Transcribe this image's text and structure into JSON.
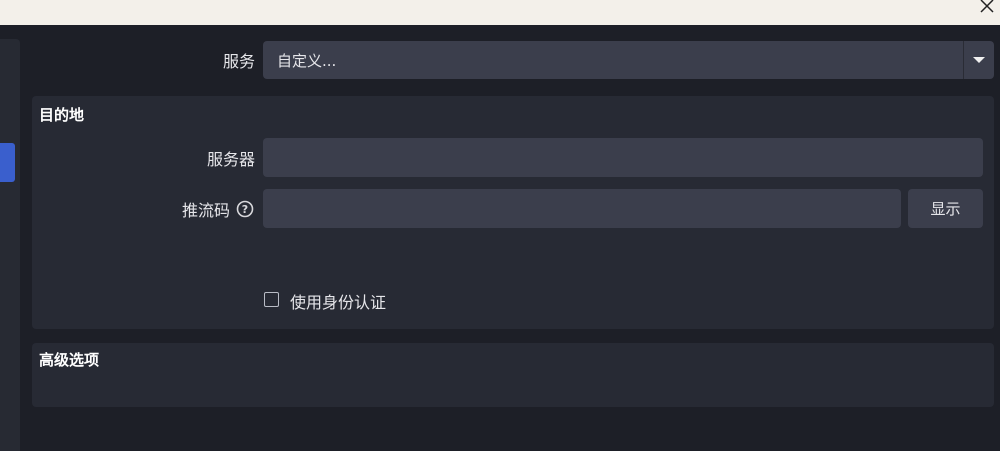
{
  "window": {
    "close_icon": "close-icon"
  },
  "service": {
    "label": "服务",
    "value": "自定义..."
  },
  "destination": {
    "title": "目的地",
    "server_label": "服务器",
    "server_value": "",
    "stream_key_label": "推流码",
    "stream_key_value": "",
    "show_button": "显示",
    "auth_label": "使用身份认证",
    "auth_checked": false
  },
  "advanced": {
    "title": "高级选项"
  },
  "colors": {
    "background": "#1d1f27",
    "panel": "#272a34",
    "field": "#3b3e4c",
    "accent": "#3a5fcd"
  }
}
